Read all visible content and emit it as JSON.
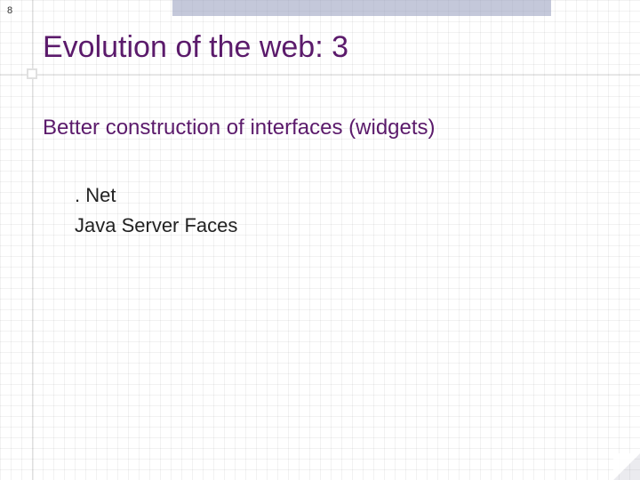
{
  "page_number": "8",
  "title": "Evolution of the web: 3",
  "subtitle": "Better construction of interfaces (widgets)",
  "items": [
    ". Net",
    "Java Server Faces"
  ]
}
